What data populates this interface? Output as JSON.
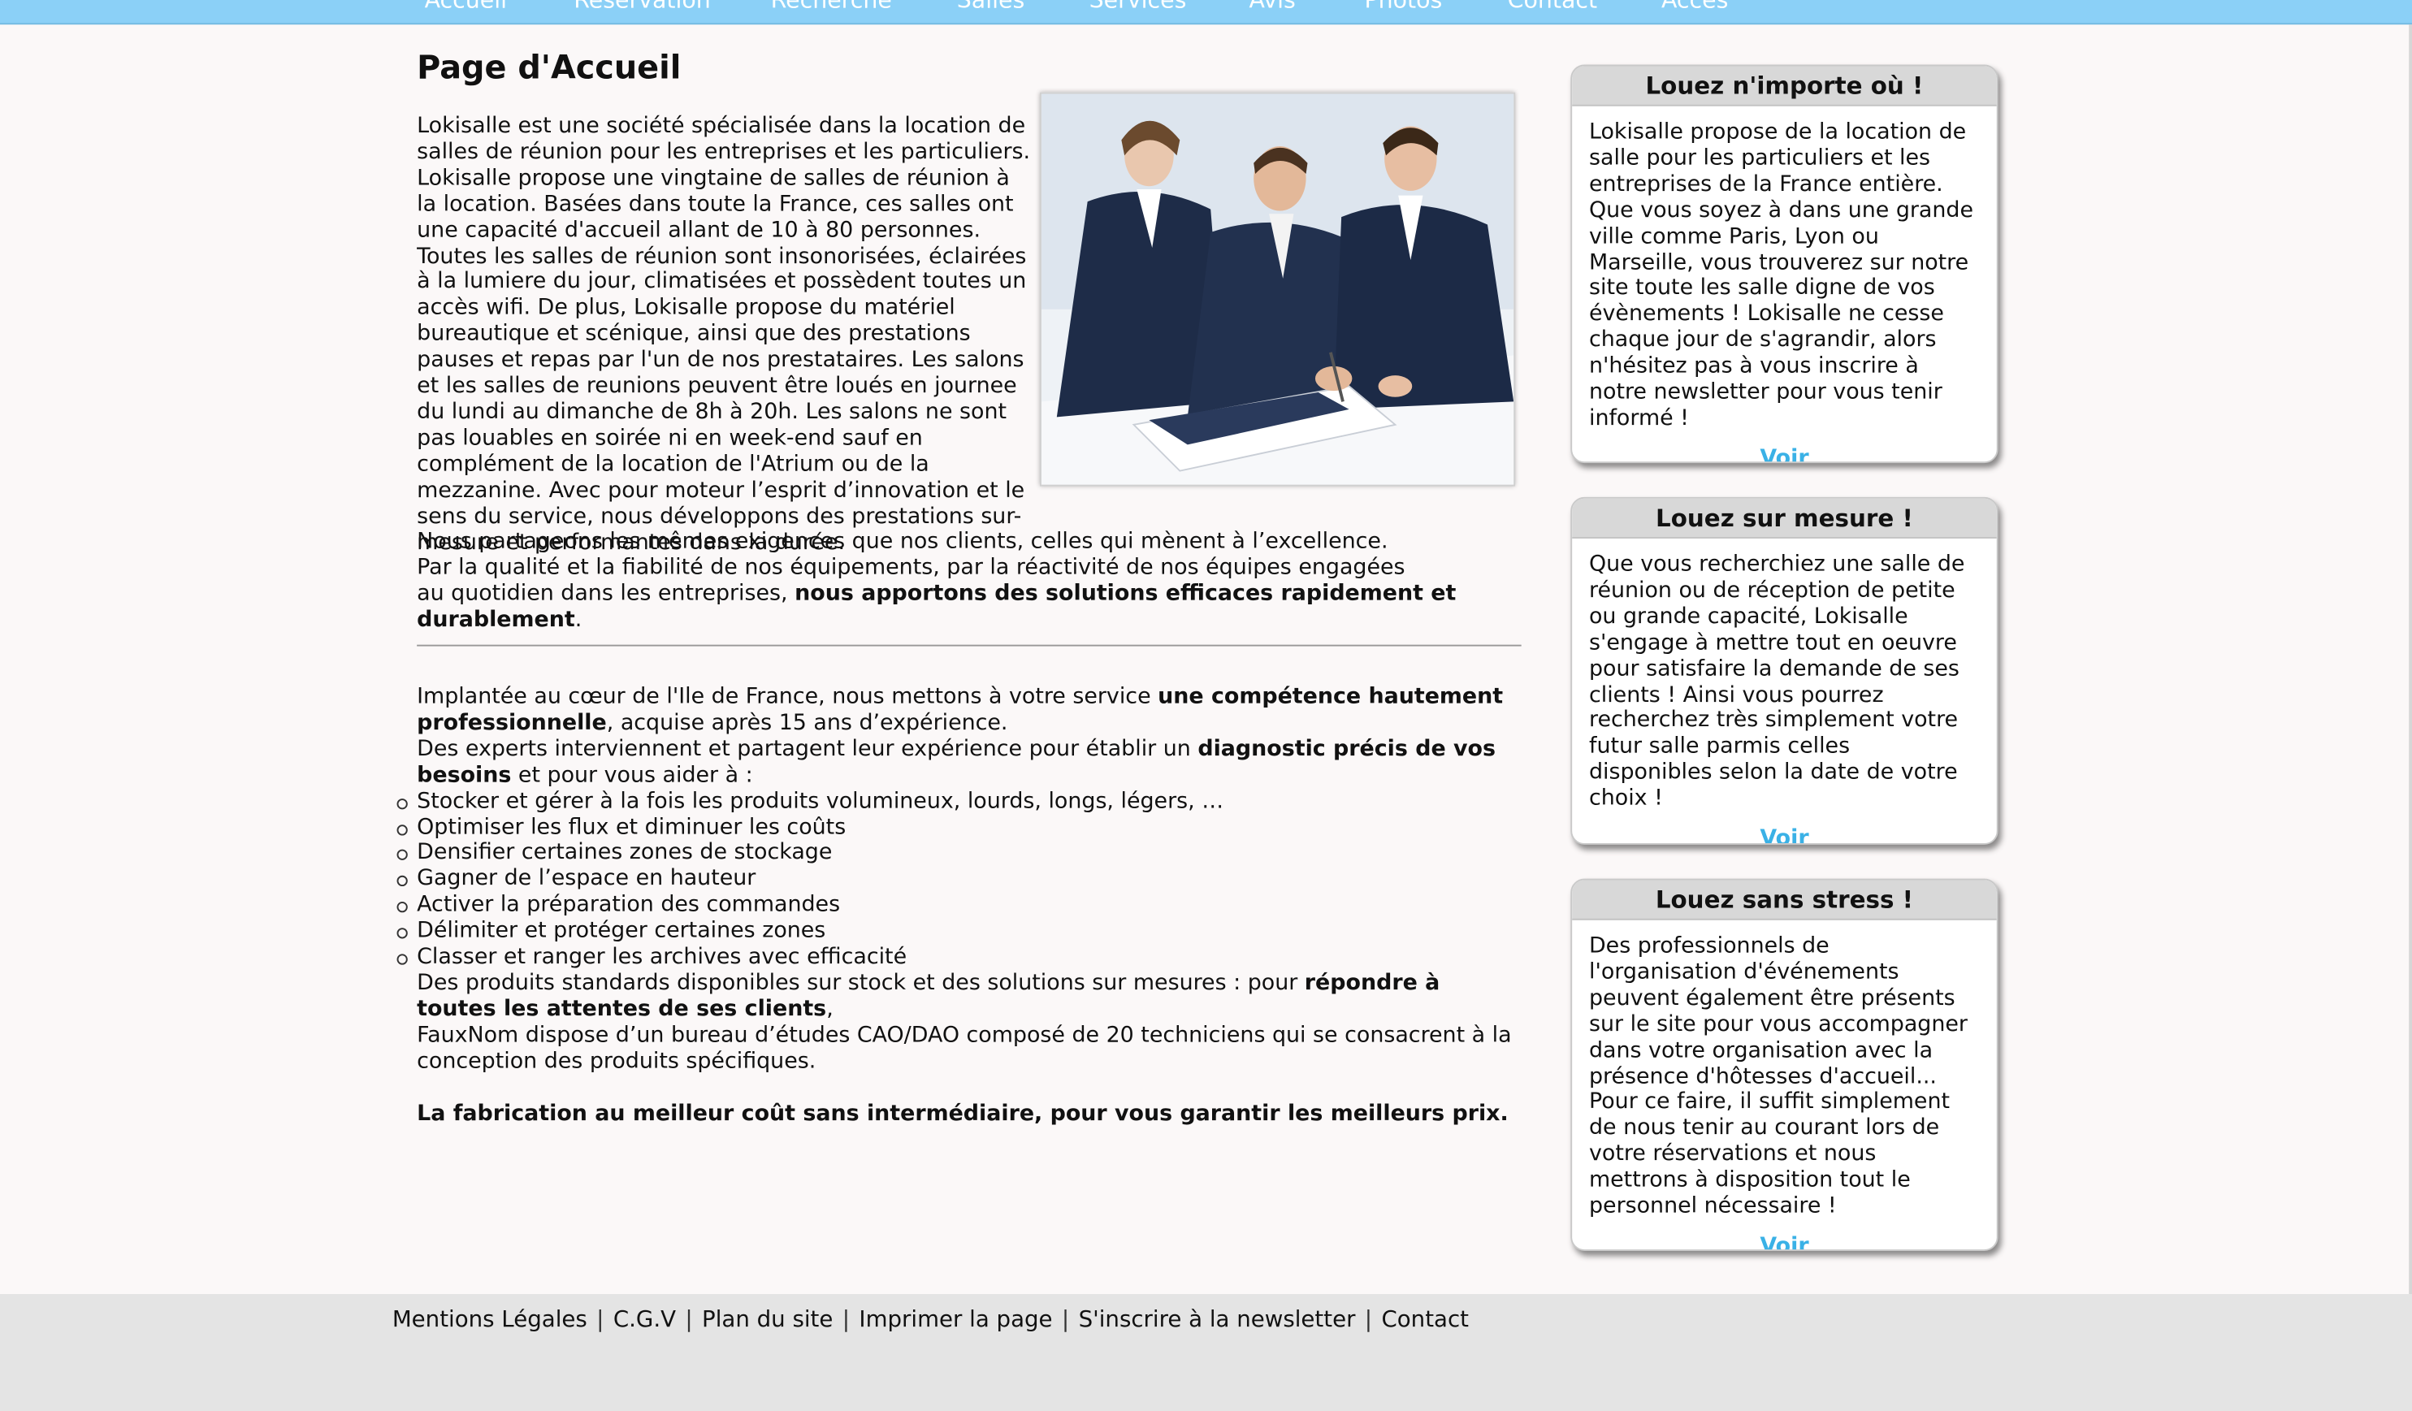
{
  "nav": {
    "items": [
      "Accueil",
      "Réservation",
      "Recherche",
      "Salles",
      "Services",
      "Avis",
      "Photos",
      "Contact",
      "Accès"
    ]
  },
  "main": {
    "title": "Page d'Accueil",
    "photo_icon": "business-meeting-photo",
    "intro_p1": "Lokisalle est une société spécialisée dans la location de salles de réunion pour les entreprises et les particuliers. Lokisalle propose une vingtaine de salles de réunion à la location. Basées dans toute la France, ces salles ont une capacité d'accueil allant de 10 à 80 personnes. Toutes les salles de réunion sont insonorisées, éclairées à la lumiere du jour, climatisées et possèdent toutes un accès wifi. De plus, Lokisalle propose du matériel bureautique et scénique, ainsi que des prestations pauses et repas par l'un de nos prestataires. Les salons et les salles de reunions peuvent être loués en journee du lundi au dimanche de 8h à 20h. Les salons ne sont pas louables en soirée ni en week-end sauf en complément de la location de l'Atrium ou de la mezzanine. Avec pour moteur l’esprit d’innovation et le sens du service, nous développons des prestations sur-mesure et performantes dans la durée.",
    "intro_p2": "Nous partageons les mêmes exigences que nos clients, celles qui mènent à l’excellence.",
    "intro_p3": "Par la qualité et la fiabilité de nos équipements, par la réactivité de nos équipes engagées",
    "intro_p4_a": "au quotidien dans les entreprises, ",
    "intro_p4_b": "nous apportons des solutions efficaces rapidement et durablement",
    "intro_p4_c": ".",
    "b2_a": "Implantée au cœur de l'Ile de France, nous mettons à votre service ",
    "b2_b": "une compétence hautement professionnelle",
    "b2_c": ", acquise après 15 ans d’expérience.",
    "b2_d": "Des experts interviennent et partagent leur expérience pour établir un ",
    "b2_e": "diagnostic précis de vos besoins",
    "b2_f": " et pour vous aider à :",
    "bullets": [
      "Stocker et gérer à la fois les produits volumineux, lourds, longs, légers, …",
      "Optimiser les flux et diminuer les coûts",
      "Densifier certaines zones de stockage",
      "Gagner de l’espace en hauteur",
      "Activer la préparation des commandes",
      "Délimiter et protéger certaines zones",
      "Classer et ranger les archives avec efficacité"
    ],
    "b3_a": "Des produits standards disponibles sur stock et des solutions sur mesures : pour ",
    "b3_b": "répondre à toutes les attentes de ses clients",
    "b3_c": ",",
    "b3_d": "FauxNom dispose d’un bureau d’études CAO/DAO composé de 20 techniciens qui se consacrent à la conception des produits spécifiques.",
    "b4": "La fabrication au meilleur coût sans intermédiaire, pour vous garantir les meilleurs prix."
  },
  "sidebar": {
    "boxes": [
      {
        "title": "Louez n'importe où !",
        "text": "Lokisalle propose de la location de salle pour les particuliers et les entreprises de la France entière. Que vous soyez à dans une grande ville comme Paris, Lyon ou Marseille, vous trouverez sur notre site toute les salle digne de vos évènements ! Lokisalle ne cesse chaque jour de s'agrandir, alors n'hésitez pas à vous inscrire à notre newsletter pour vous tenir informé !",
        "link": "Voir"
      },
      {
        "title": "Louez sur mesure !",
        "text": "Que vous recherchiez une salle de réunion ou de réception de petite ou grande capacité, Lokisalle s'engage à mettre tout en oeuvre pour satisfaire la demande de ses clients ! Ainsi vous pourrez recherchez très simplement votre futur salle parmis celles disponibles selon la date de votre choix !",
        "link": "Voir"
      },
      {
        "title": "Louez sans stress !",
        "text": "Des professionnels de l'organisation d'événements peuvent également être présents sur le site pour vous accompagner dans votre organisation avec la présence d'hôtesses d'accueil... Pour ce faire, il suffit simplement de nous tenir au courant lors de votre réservations et nous mettrons à disposition tout le personnel nécessaire !",
        "link": "Voir"
      }
    ]
  },
  "footer": {
    "links": [
      "Mentions Légales",
      "C.G.V",
      "Plan du site",
      "Imprimer la page",
      "S'inscrire à la newsletter",
      "Contact"
    ],
    "separator": "|"
  },
  "colors": {
    "nav_bg": "#8bd0f7",
    "page_bg": "#fbf8f8",
    "footer_bg": "#e4e4e4",
    "link": "#3ab1e6",
    "box_title_bg": "#d8d8d8"
  }
}
